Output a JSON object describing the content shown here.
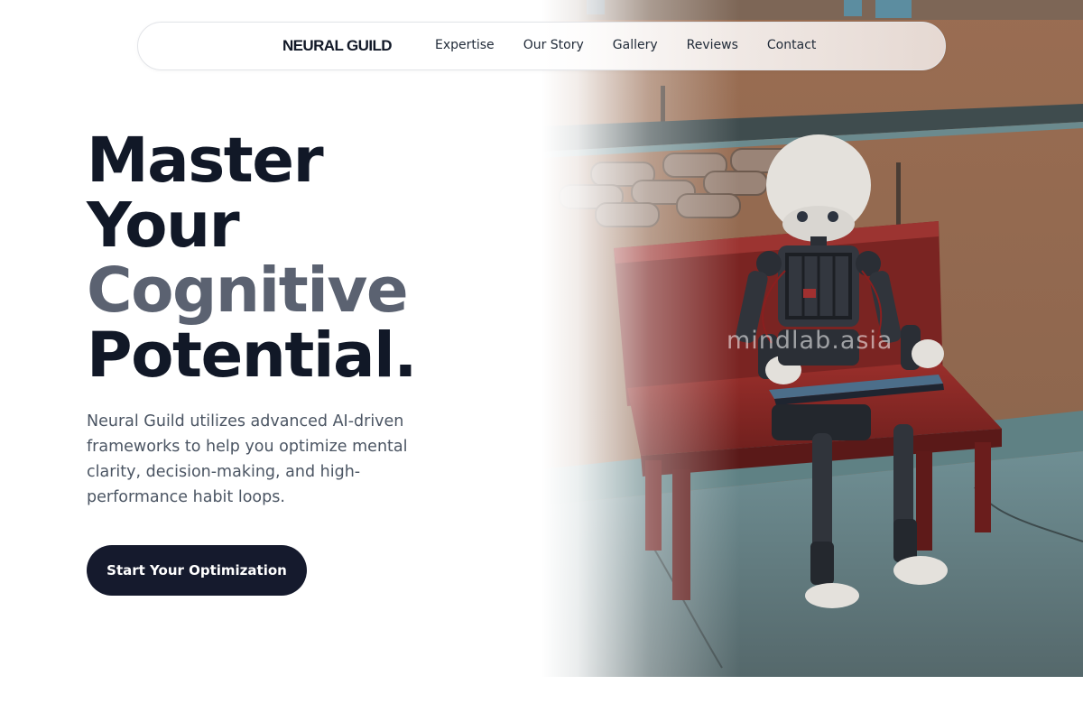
{
  "nav": {
    "brand": "NEURAL GUILD",
    "links": [
      "Expertise",
      "Our Story",
      "Gallery",
      "Reviews",
      "Contact"
    ]
  },
  "hero": {
    "headline": {
      "line1": "Master",
      "line2": "Your",
      "line3": "Cognitive",
      "line4": "Potential."
    },
    "description": "Neural Guild utilizes advanced AI-driven frameworks to help you optimize mental clarity, decision-making, and high-performance habit loops.",
    "cta_label": "Start Your Optimization",
    "image_watermark": "mindlab.asia"
  },
  "colors": {
    "text_dark": "#111827",
    "text_muted": "#5b6271",
    "body_text": "#4b5563",
    "cta_background": "#151a2d"
  }
}
